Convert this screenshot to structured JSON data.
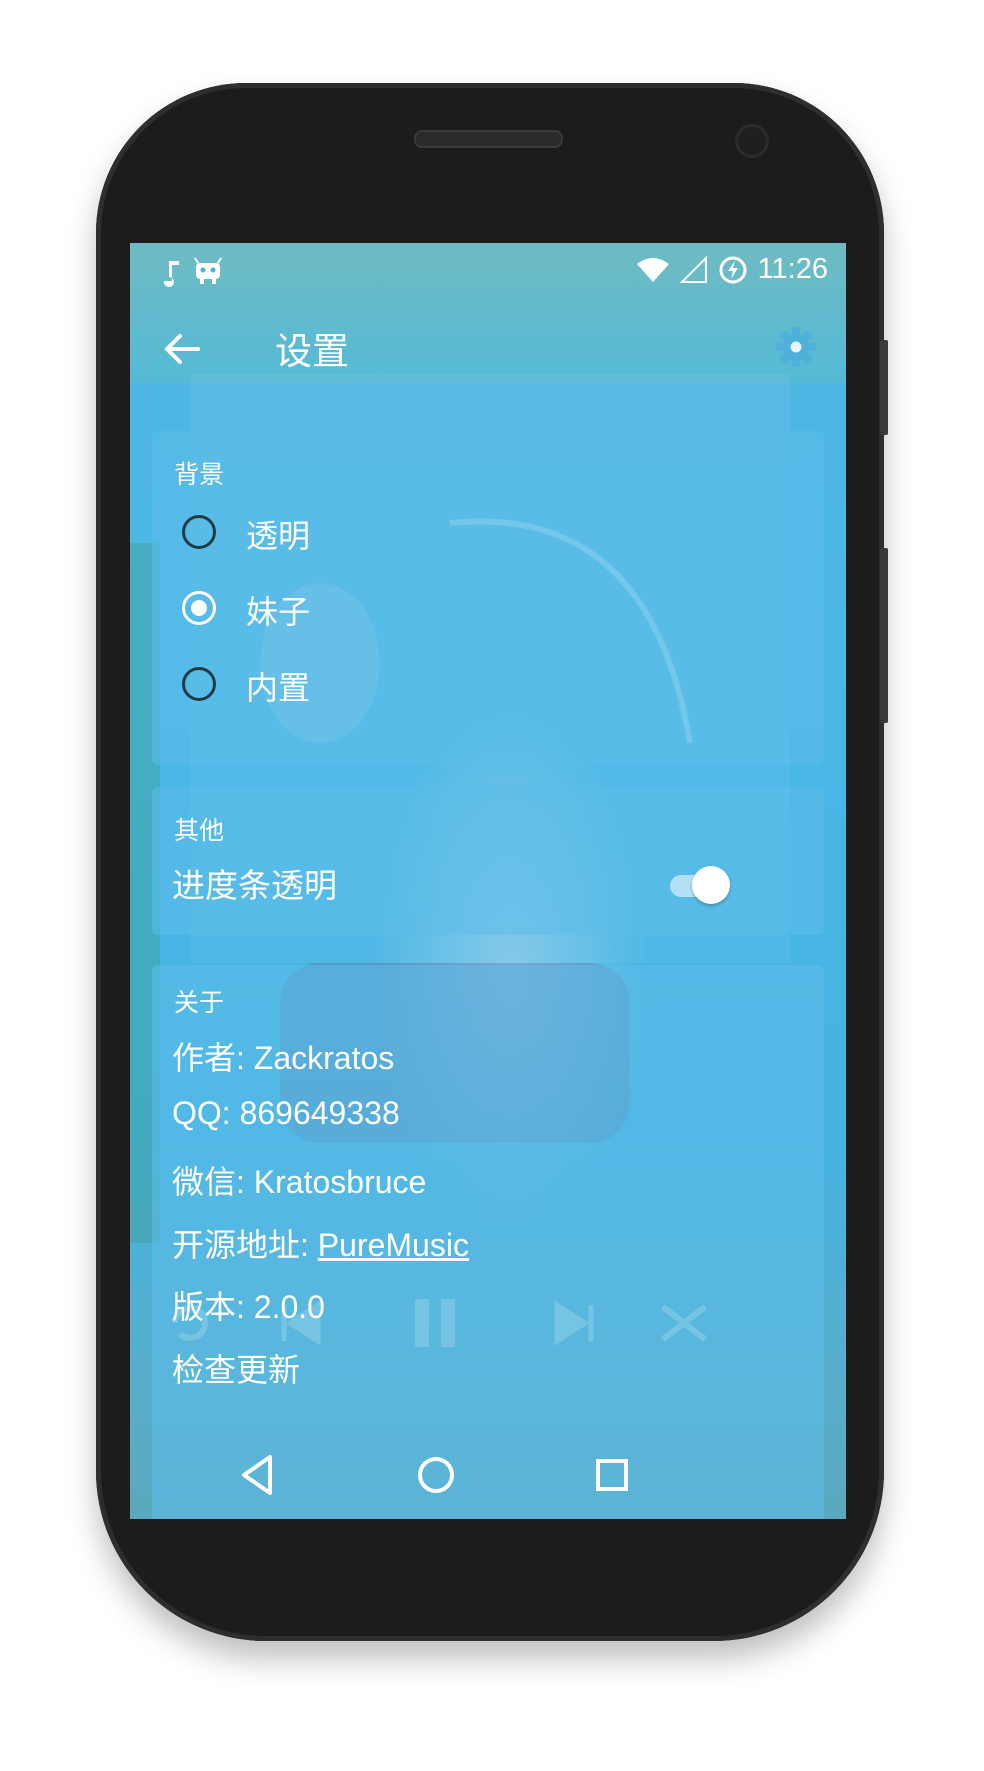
{
  "status_bar": {
    "time": "11:26",
    "left_icons": [
      "music-note-icon",
      "cyanogen-bot-icon"
    ],
    "right_icons": [
      "wifi-icon",
      "signal-icon",
      "battery-charging-icon"
    ]
  },
  "toolbar": {
    "title": "设置",
    "back_icon": "arrow-left-icon",
    "action_icon": "gear-icon"
  },
  "background_section": {
    "label": "背景",
    "options": [
      {
        "label": "透明",
        "checked": false
      },
      {
        "label": "妹子",
        "checked": true
      },
      {
        "label": "内置",
        "checked": false
      }
    ]
  },
  "other_section": {
    "label": "其他",
    "progress_transparent_label": "进度条透明",
    "progress_transparent_on": true
  },
  "about_section": {
    "label": "关于",
    "author": "作者: Zackratos",
    "qq": "QQ: 869649338",
    "wechat": "微信: Kratosbruce",
    "source_prefix": "开源地址: ",
    "source_link": "PureMusic",
    "version": "版本: 2.0.0",
    "check_update": "检查更新"
  },
  "nav_bar": {
    "icons": [
      "back-triangle-icon",
      "home-circle-icon",
      "recents-square-icon"
    ]
  }
}
